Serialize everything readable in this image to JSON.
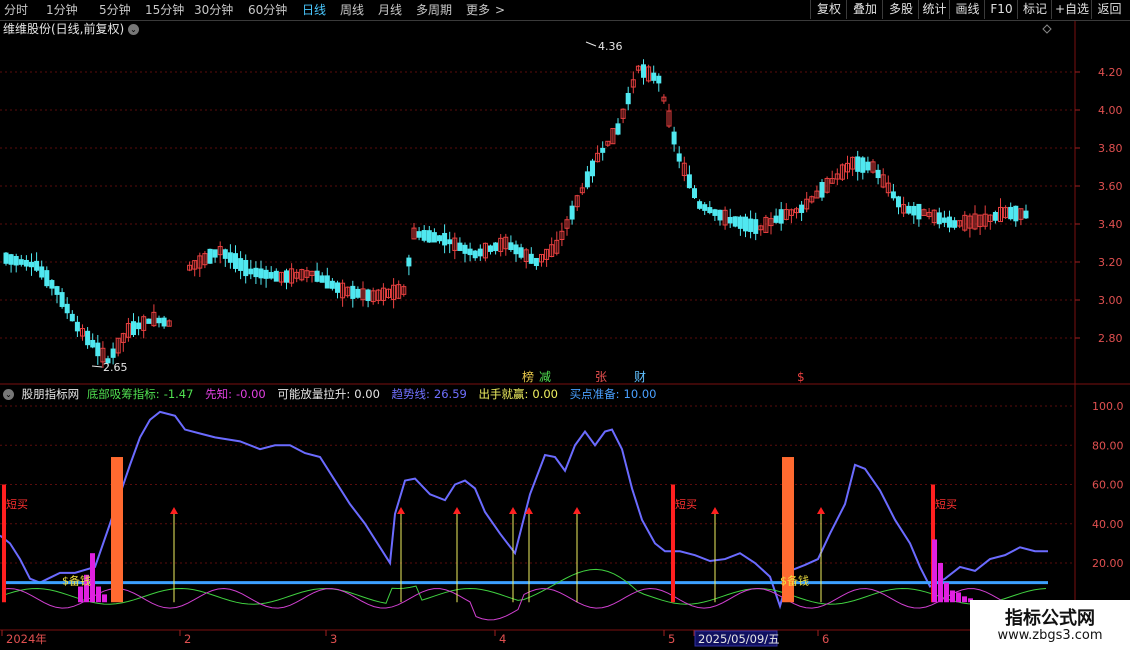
{
  "toolbar": {
    "periods": [
      "分时",
      "1分钟",
      "5分钟",
      "15分钟",
      "30分钟",
      "60分钟",
      "日线",
      "周线",
      "月线",
      "多周期",
      "更多"
    ],
    "active_period": "日线",
    "more_arrow": ">",
    "right_buttons": [
      "复权",
      "叠加",
      "多股",
      "统计",
      "画线",
      "F10",
      "标记",
      "+自选",
      "返回"
    ]
  },
  "main_chart": {
    "title": "维维股份(日线,前复权)",
    "price_axis": [
      "4.20",
      "4.00",
      "3.80",
      "3.60",
      "3.40",
      "3.20",
      "3.00",
      "2.80"
    ],
    "high_label": "4.36",
    "low_label": "2.65",
    "event_markers": [
      {
        "text": "榜",
        "color": "#e8c84a"
      },
      {
        "text": "减",
        "color": "#50e050"
      },
      {
        "text": "张",
        "color": "#e85050"
      },
      {
        "text": "财",
        "color": "#60c0ff"
      },
      {
        "text": "$",
        "color": "#e84040"
      }
    ]
  },
  "indicator": {
    "name": "股朋指标网",
    "fields": [
      {
        "label": "底部吸筹指标:",
        "value": "-1.47",
        "color": "#50e050"
      },
      {
        "label": "先知:",
        "value": "-0.00",
        "color": "#e040e0"
      },
      {
        "label": "可能放量拉升:",
        "value": "0.00",
        "color": "#e6e6e6"
      },
      {
        "label": "趋势线:",
        "value": "26.59",
        "color": "#7070ff"
      },
      {
        "label": "出手就赢:",
        "value": "0.00",
        "color": "#f0f060"
      },
      {
        "label": "买点准备:",
        "value": "10.00",
        "color": "#4aa0ff"
      }
    ],
    "axis": [
      "100.0",
      "80.00",
      "60.00",
      "40.00",
      "20.00"
    ],
    "labels": {
      "short_buy": "短买",
      "reserve_money": "$备钱"
    }
  },
  "time_axis": {
    "labels": [
      "2024年",
      "2",
      "3",
      "4",
      "5",
      "2025/05/09/五",
      "6"
    ]
  },
  "watermark": {
    "line1": "指标公式网",
    "line2": "www.zbgs3.com"
  },
  "colors": {
    "up": "#e84040",
    "down": "#50e8f0",
    "trend": "#6b6bff",
    "buy_line": "#3ca0ff",
    "bar_orange": "#ff6a30"
  }
}
